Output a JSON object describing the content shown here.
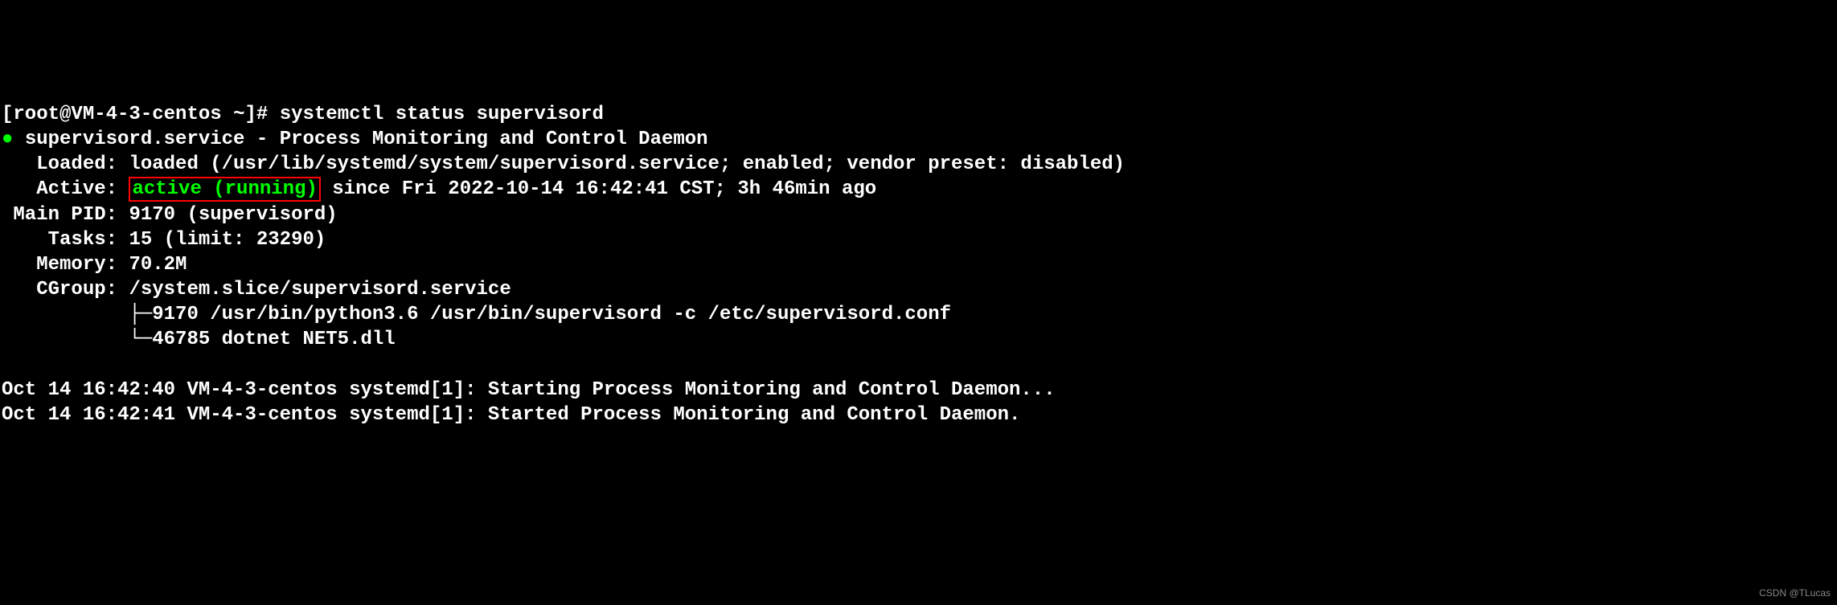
{
  "prompt": {
    "user": "root",
    "host": "VM-4-3-centos",
    "path": "~",
    "symbol": "#",
    "command": "systemctl status supervisord"
  },
  "service": {
    "bullet": "●",
    "name": "supervisord.service",
    "description": "Process Monitoring and Control Daemon"
  },
  "loaded": {
    "label": "   Loaded:",
    "value": "loaded (/usr/lib/systemd/system/supervisord.service; enabled; vendor preset: disabled)"
  },
  "active": {
    "label": "   Active:",
    "status": "active (running)",
    "since": "since Fri 2022-10-14 16:42:41 CST; 3h 46min ago"
  },
  "mainpid": {
    "label": " Main PID:",
    "value": "9170 (supervisord)"
  },
  "tasks": {
    "label": "    Tasks:",
    "value": "15 (limit: 23290)"
  },
  "memory": {
    "label": "   Memory:",
    "value": "70.2M"
  },
  "cgroup": {
    "label": "   CGroup:",
    "value": "/system.slice/supervisord.service",
    "tree1_prefix": "           ├─",
    "tree1": "9170 /usr/bin/python3.6 /usr/bin/supervisord -c /etc/supervisord.conf",
    "tree2_prefix": "           └─",
    "tree2": "46785 dotnet NET5.dll"
  },
  "logs": {
    "line1": "Oct 14 16:42:40 VM-4-3-centos systemd[1]: Starting Process Monitoring and Control Daemon...",
    "line2": "Oct 14 16:42:41 VM-4-3-centos systemd[1]: Started Process Monitoring and Control Daemon."
  },
  "watermark": "CSDN @TLucas"
}
